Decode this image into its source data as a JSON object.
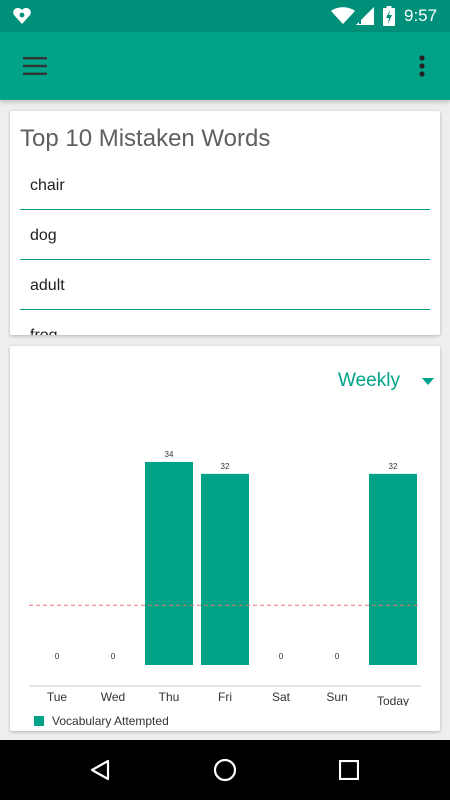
{
  "status_bar": {
    "time": "9:57"
  },
  "mistakes": {
    "title": "Top 10 Mistaken Words",
    "words": [
      "chair",
      "dog",
      "adult",
      "frog"
    ]
  },
  "period": {
    "selected": "Weekly"
  },
  "chart_data": {
    "type": "bar",
    "categories": [
      "Tue",
      "Wed",
      "Thu",
      "Fri",
      "Sat",
      "Sun",
      "Today"
    ],
    "series": [
      {
        "name": "Vocabulary Attempted",
        "values": [
          0,
          0,
          34,
          32,
          0,
          0,
          32
        ]
      }
    ],
    "data_labels": [
      "0",
      "0",
      "34",
      "32",
      "0",
      "0",
      "32"
    ],
    "reference_line": {
      "value": 10,
      "style": "dashed",
      "color": "#e57373"
    },
    "ylim": [
      0,
      36
    ],
    "legend": {
      "label": "Vocabulary Attempted",
      "placement": "bottom-left"
    },
    "colors": {
      "bar": "#00a388"
    }
  },
  "colors": {
    "primary": "#00a388",
    "primary_dark": "#00907a"
  }
}
